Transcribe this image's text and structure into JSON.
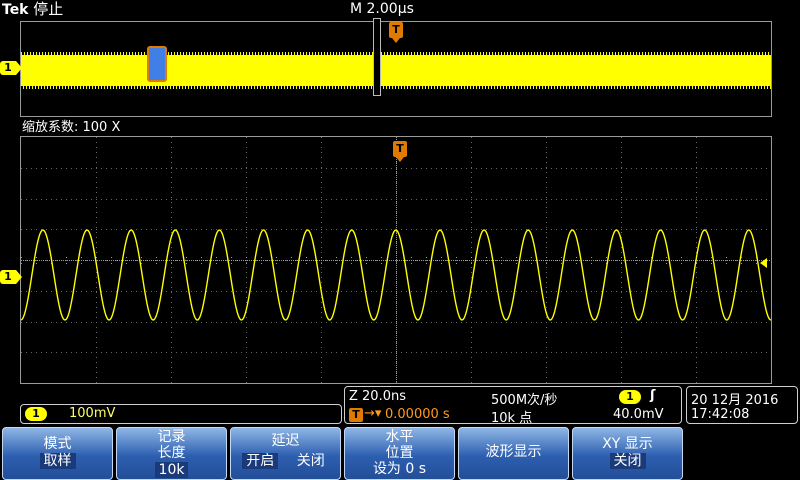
{
  "brand": {
    "logo": "Tek",
    "run_state": "停止"
  },
  "timebase": {
    "label": "M 2.00µs"
  },
  "overview": {
    "trigger_marker": "T",
    "channel_marker": "1"
  },
  "zoom": {
    "label": "缩放系数: 100 X",
    "trigger_marker": "T",
    "channel_marker": "1"
  },
  "waveform": {
    "channel": 1,
    "color": "#ffff00",
    "cycles": 17,
    "shape": "sine"
  },
  "channel_scale": {
    "channel": "1",
    "value": "100mV"
  },
  "acquisition": {
    "zoom_time": "Z 20.0ns",
    "sample_rate": "500M次/秒",
    "trigger_channel": "1",
    "trigger_slope_icon": "rising-edge-icon",
    "trigger_position": "0.00000 s",
    "record_points": "10k 点",
    "trigger_level": "40.0mV"
  },
  "clock": {
    "date": "20 12月 2016",
    "time": "17:42:08"
  },
  "softkeys": [
    {
      "title": "模式",
      "value": "取样"
    },
    {
      "title1": "记录",
      "title2": "长度",
      "value": "10k"
    },
    {
      "title": "延迟",
      "opt_on": "开启",
      "opt_off": "关闭"
    },
    {
      "title1": "水平",
      "title2": "位置",
      "value": "设为 0 s"
    },
    {
      "title": "波形显示"
    },
    {
      "title": "XY 显示",
      "value": "关闭"
    }
  ],
  "colors": {
    "trace": "#ffff00",
    "trigger": "#e07a00",
    "softkey": "#2d5fb0",
    "cursor": "#3f7fe6"
  }
}
